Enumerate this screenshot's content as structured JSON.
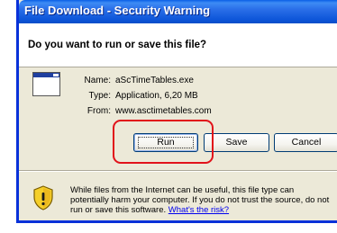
{
  "dialog": {
    "title": "File Download - Security Warning",
    "question": "Do you want to run or save this file?"
  },
  "file_info": {
    "name_label": "Name:",
    "name_value": "aScTimeTables.exe",
    "type_label": "Type:",
    "type_value": "Application, 6,20 MB",
    "from_label": "From:",
    "from_value": "www.asctimetables.com"
  },
  "buttons": {
    "run_label": "Run",
    "save_label": "Save",
    "cancel_label": "Cancel"
  },
  "warning": {
    "line1": "While files from the Internet can be useful, this file type can",
    "line2": "potentially harm your computer. If you do not trust the source, do not",
    "line3": "run or save this software.",
    "link": "What's the risk?"
  },
  "colors": {
    "title_bar": "#0a5fe6",
    "dialog_background": "#ece9d8",
    "highlight_ring": "#e1121a",
    "link": "#0000ee"
  },
  "icons": {
    "file": "application-window-icon",
    "warning": "security-shield-icon"
  }
}
